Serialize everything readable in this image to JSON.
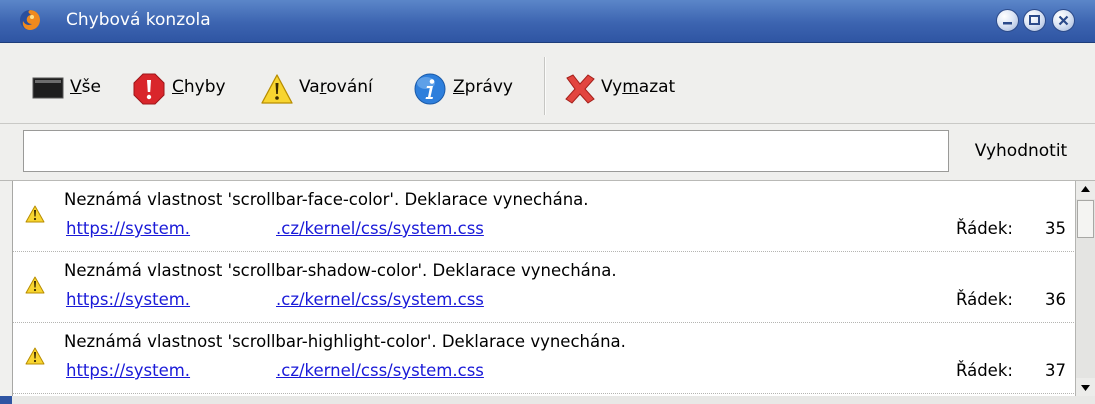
{
  "window": {
    "title": "Chybová konzola"
  },
  "toolbar": {
    "all": {
      "mnemonic": "V",
      "rest": "še",
      "icon": "monitor-icon"
    },
    "errors": {
      "mnemonic": "C",
      "rest": "hyby",
      "icon": "error-icon"
    },
    "warnings": {
      "prefix": "Va",
      "mnemonic": "r",
      "rest": "ování",
      "icon": "warning-icon"
    },
    "messages": {
      "mnemonic": "Z",
      "rest": "právy",
      "icon": "info-icon"
    },
    "clear": {
      "prefix": "Vy",
      "mnemonic": "m",
      "rest": "azat",
      "icon": "clear-x-icon"
    }
  },
  "evaluate": {
    "input_value": "",
    "button_label": "Vyhodnotit"
  },
  "messages": [
    {
      "text": "Neznámá vlastnost 'scrollbar-face-color'. Deklarace vynechána.",
      "url_start": "https://system.",
      "url_end": ".cz/kernel/css/system.css",
      "line_label": "Řádek:",
      "line_number": "35",
      "icon": "warning-icon"
    },
    {
      "text": "Neznámá vlastnost 'scrollbar-shadow-color'. Deklarace vynechána.",
      "url_start": "https://system.",
      "url_end": ".cz/kernel/css/system.css",
      "line_label": "Řádek:",
      "line_number": "36",
      "icon": "warning-icon"
    },
    {
      "text": "Neznámá vlastnost 'scrollbar-highlight-color'. Deklarace vynechána.",
      "url_start": "https://system.",
      "url_end": ".cz/kernel/css/system.css",
      "line_label": "Řádek:",
      "line_number": "37",
      "icon": "warning-icon"
    }
  ],
  "colors": {
    "titlebar": "#3c64b0",
    "link": "#1a1ad8",
    "warning": "#f2c200",
    "error": "#d9262b",
    "info": "#2e7fdc"
  }
}
